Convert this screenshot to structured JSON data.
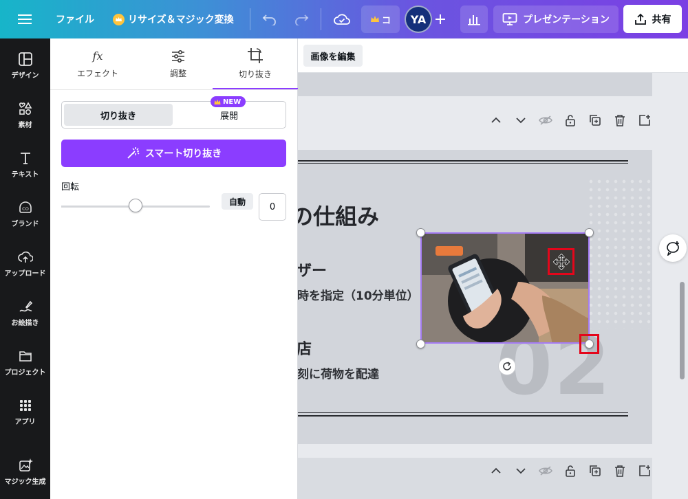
{
  "topbar": {
    "file_label": "ファイル",
    "resize_label": "リサイズ＆マジック変換",
    "pro_label": "コ",
    "avatar_initials": "YA",
    "present_label": "プレゼンテーション",
    "share_label": "共有"
  },
  "rail": {
    "items": [
      {
        "label": "デザイン",
        "icon": "layout-icon"
      },
      {
        "label": "素材",
        "icon": "elements-icon"
      },
      {
        "label": "テキスト",
        "icon": "text-icon"
      },
      {
        "label": "ブランド",
        "icon": "brand-icon"
      },
      {
        "label": "アップロード",
        "icon": "upload-icon"
      },
      {
        "label": "お絵描き",
        "icon": "draw-icon"
      },
      {
        "label": "プロジェクト",
        "icon": "folder-icon"
      },
      {
        "label": "アプリ",
        "icon": "apps-icon"
      },
      {
        "label": "マジック生成",
        "icon": "magic-media-icon"
      }
    ]
  },
  "panel": {
    "tabs": [
      {
        "label": "エフェクト",
        "icon": "fx-icon"
      },
      {
        "label": "調整",
        "icon": "sliders-icon"
      },
      {
        "label": "切り抜き",
        "icon": "crop-icon"
      }
    ],
    "segment": {
      "crop": "切り抜き",
      "expand": "展開",
      "new_badge": "NEW"
    },
    "smart_crop_label": "スマート切り抜き",
    "rotation": {
      "label": "回転",
      "auto_label": "自動",
      "value": "0",
      "slider_fraction": 0.5
    }
  },
  "context_bar": {
    "edit_image_label": "画像を編集"
  },
  "slide": {
    "title": "の仕組み",
    "heading1": "ザー",
    "text1": "時を指定（10分単位）",
    "heading2": "店",
    "text2": "刻に荷物を配達",
    "big_number": "02"
  },
  "colors": {
    "accent": "#8b3dff",
    "highlight": "#e4061b",
    "rail_bg": "#18191b"
  }
}
